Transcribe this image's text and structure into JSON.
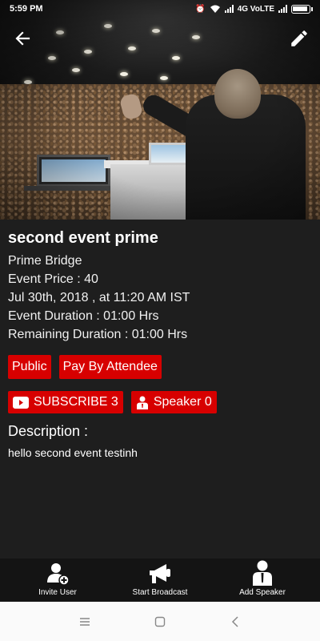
{
  "status_bar": {
    "time": "5:59 PM",
    "network": "4G VoLTE"
  },
  "event": {
    "title": "second event prime",
    "organizer": "Prime Bridge",
    "price": "Event Price : 40",
    "datetime": "Jul 30th, 2018 , at 11:20 AM IST",
    "duration": "Event Duration : 01:00 Hrs",
    "remaining": "Remaining Duration : 01:00 Hrs"
  },
  "tags": {
    "visibility": "Public",
    "payment": "Pay By Attendee"
  },
  "stats": {
    "subscribe_label": "SUBSCRIBE 3",
    "speaker_label": "Speaker 0"
  },
  "description": {
    "heading": "Description :",
    "text": "hello second event testinh"
  },
  "bottom_actions": {
    "invite": "Invite User",
    "broadcast": "Start Broadcast",
    "add_speaker": "Add Speaker"
  },
  "colors": {
    "accent": "#d70000",
    "background": "#1e1e1e",
    "bottom_bar": "#141414"
  }
}
